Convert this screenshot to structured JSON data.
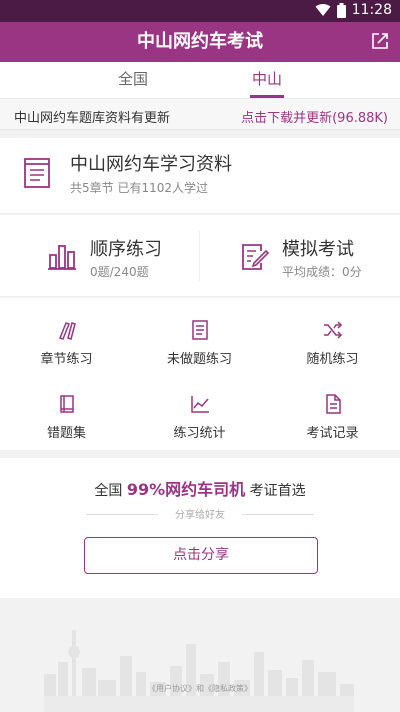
{
  "status": {
    "time": "11:28"
  },
  "app": {
    "title": "中山网约车考试"
  },
  "tabs": [
    {
      "label": "全国"
    },
    {
      "label": "中山"
    }
  ],
  "notice": {
    "text": "中山网约车题库资料有更新",
    "action": "点击下载并更新(96.88K)"
  },
  "materials": {
    "title": "中山网约车学习资料",
    "subtitle": "共5章节 已有1102人学过"
  },
  "practice": {
    "sequential": {
      "title": "顺序练习",
      "subtitle": "0题/240题"
    },
    "mock": {
      "title": "模拟考试",
      "subtitle": "平均成绩：0分"
    }
  },
  "grid": [
    {
      "label": "章节练习",
      "icon": "chapter-icon"
    },
    {
      "label": "未做题练习",
      "icon": "undone-icon"
    },
    {
      "label": "随机练习",
      "icon": "shuffle-icon"
    },
    {
      "label": "错题集",
      "icon": "wrong-book-icon"
    },
    {
      "label": "练习统计",
      "icon": "stats-icon"
    },
    {
      "label": "考试记录",
      "icon": "exam-record-icon"
    }
  ],
  "promo": {
    "prefix": "全国",
    "highlight": "99%网约车司机",
    "suffix": "考证首选",
    "share_hint": "分享给好友",
    "share_button": "点击分享"
  },
  "footer": {
    "links": "《用户协议》和《隐私政策》"
  },
  "colors": {
    "brand": "#9a3584",
    "status_bar": "#4b1a45"
  }
}
